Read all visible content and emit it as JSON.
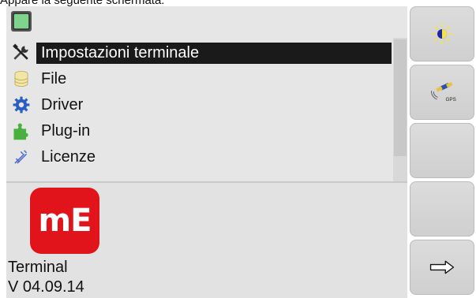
{
  "caption": {
    "text": "Appare la seguente schermata:"
  },
  "header": {
    "icon": "terminal-screen-icon"
  },
  "menu": {
    "items": [
      {
        "label": "Impostazioni terminale",
        "icon": "tools-icon",
        "selected": true
      },
      {
        "label": "File",
        "icon": "database-icon",
        "selected": false
      },
      {
        "label": "Driver",
        "icon": "gear-icon",
        "selected": false
      },
      {
        "label": "Plug-in",
        "icon": "puzzle-icon",
        "selected": false
      },
      {
        "label": "Licenze",
        "icon": "license-icon",
        "selected": false
      }
    ]
  },
  "info": {
    "logo_text": "mE",
    "name": "Terminal",
    "version": "V 04.09.14"
  },
  "softkeys": [
    {
      "icon": "brightness-icon"
    },
    {
      "icon": "gps-icon",
      "label": "GPS"
    },
    {
      "icon": "empty"
    },
    {
      "icon": "empty"
    },
    {
      "icon": "next-arrow-icon"
    }
  ],
  "colors": {
    "brand_red": "#e1141c",
    "selection_bg": "#1a1a1a",
    "panel_bg": "#e6e6e6"
  }
}
